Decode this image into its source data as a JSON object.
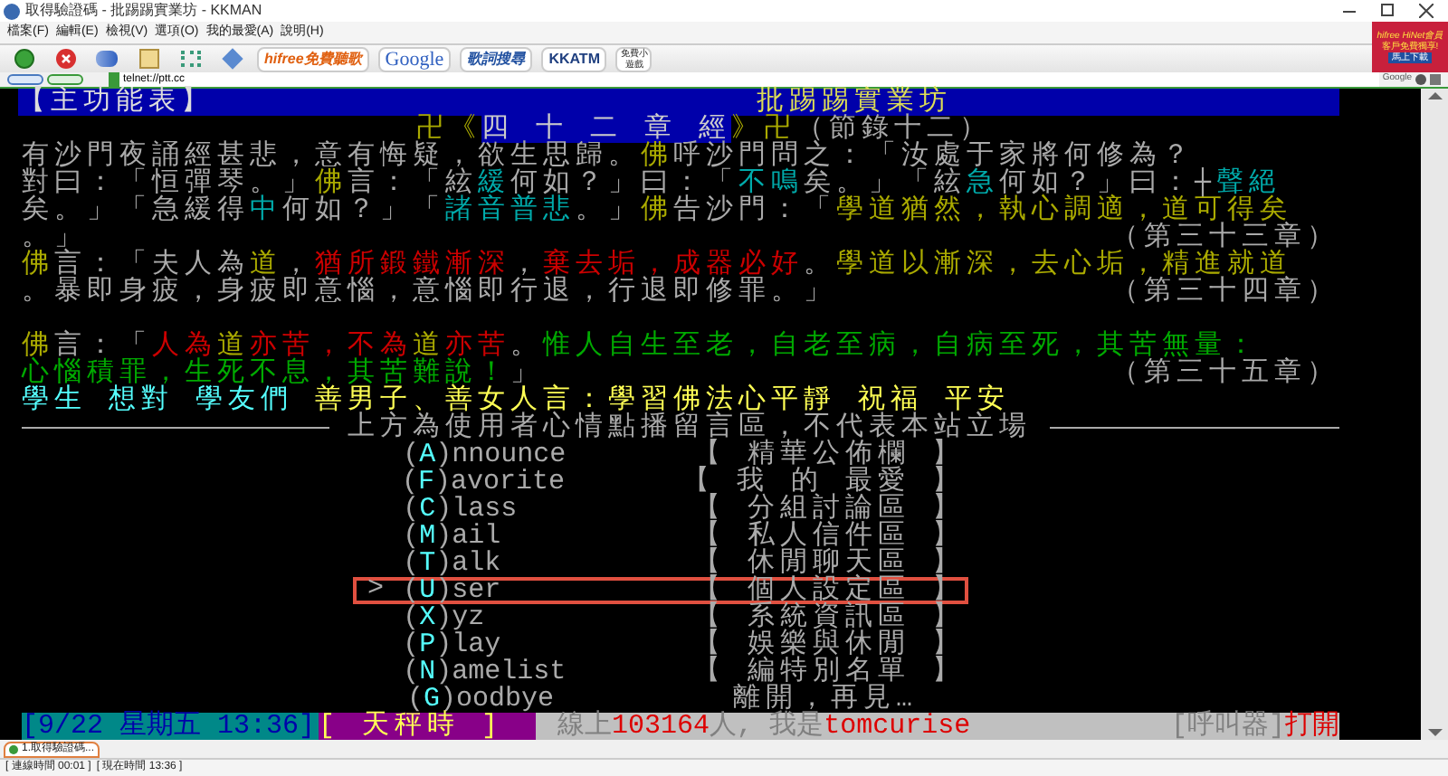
{
  "window": {
    "title": "取得驗證碼 - 批踢踢實業坊 - KKMAN"
  },
  "menu_bar": [
    "檔案(F)",
    "編輯(E)",
    "檢視(V)",
    "選項(O)",
    "我的最愛(A)",
    "說明(H)"
  ],
  "toolbar": {
    "links": [
      {
        "kind": "hifree",
        "label": "hifree免費聽歌"
      },
      {
        "kind": "google",
        "label": "Google"
      },
      {
        "kind": "lyrics",
        "label": "歌詞搜尋"
      },
      {
        "kind": "kkatm",
        "label": "KKATM"
      },
      {
        "kind": "games",
        "label": "免費小遊戲"
      }
    ]
  },
  "ad_banner": {
    "brand": "hifree",
    "title": "HiNet會員",
    "text": "客戶免費獨享!",
    "button": "馬上下載"
  },
  "address_bar": {
    "value": "telnet://ptt.cc",
    "search_label": "Google"
  },
  "terminal": {
    "header_left": "【主功能表】",
    "header_right": "批踢踢實業坊",
    "heading": [
      {
        "text": "卍《",
        "kind": "ornament"
      },
      {
        "text": "四 十 二 章 經",
        "kind": "highlight"
      },
      {
        "text": "》卍",
        "kind": "ornament"
      },
      {
        "text": "（節錄十二）",
        "kind": "note"
      }
    ],
    "sections": [
      {
        "lines": [
          {
            "segments": [
              {
                "text": "有沙門夜誦經甚悲，意有悔疑，欲生思歸。",
                "color": "#aaaaaa"
              },
              {
                "text": "佛",
                "color": "#aaaa00"
              },
              {
                "text": "呼沙門問之：「汝處于家將何修為？",
                "color": "#aaaaaa"
              }
            ]
          },
          {
            "segments": [
              {
                "text": "對曰：「恒彈琴。」",
                "color": "#aaaaaa"
              },
              {
                "text": "佛",
                "color": "#aaaa00"
              },
              {
                "text": "言：「絃",
                "color": "#aaaaaa"
              },
              {
                "text": "緩",
                "color": "#00aaaa"
              },
              {
                "text": "何如？」曰：「",
                "color": "#aaaaaa"
              },
              {
                "text": "不鳴",
                "color": "#00aaaa"
              },
              {
                "text": "矣。」「絃",
                "color": "#aaaaaa"
              },
              {
                "text": "急",
                "color": "#00aaaa"
              },
              {
                "text": "何如？」曰：┼",
                "color": "#aaaaaa"
              },
              {
                "text": "聲絕",
                "color": "#00aaaa"
              }
            ]
          },
          {
            "segments": [
              {
                "text": "矣。」「急緩得",
                "color": "#aaaaaa"
              },
              {
                "text": "中",
                "color": "#00aaaa"
              },
              {
                "text": "何如？」「",
                "color": "#aaaaaa"
              },
              {
                "text": "諸音普悲",
                "color": "#00aaaa"
              },
              {
                "text": "。」",
                "color": "#aaaaaa"
              },
              {
                "text": "佛",
                "color": "#aaaa00"
              },
              {
                "text": "告沙門：「",
                "color": "#aaaaaa"
              },
              {
                "text": "學道猶然，執心調適，道可得矣",
                "color": "#aaaa00"
              }
            ]
          },
          {
            "segments": [
              {
                "text": "。」",
                "color": "#aaaaaa"
              }
            ],
            "right": {
              "text": "（第三十三章）",
              "color": "#aaaaaa"
            }
          },
          {
            "segments": [
              {
                "text": "佛",
                "color": "#aaaa00"
              },
              {
                "text": "言：「夫人為",
                "color": "#aaaaaa"
              },
              {
                "text": "道",
                "color": "#aaaa00"
              },
              {
                "text": "，",
                "color": "#aaaaaa"
              },
              {
                "text": "猶所鍛鐵漸深",
                "color": "#cc0000"
              },
              {
                "text": "，",
                "color": "#aaaaaa"
              },
              {
                "text": "棄去垢",
                "color": "#cc0000"
              },
              {
                "text": "，",
                "color": "#cc0000"
              },
              {
                "text": "成器必好",
                "color": "#cc0000"
              },
              {
                "text": "。",
                "color": "#aaaaaa"
              },
              {
                "text": "學道以漸深，去心垢，精進就道",
                "color": "#aaaa00"
              }
            ]
          },
          {
            "segments": [
              {
                "text": "。暴即身疲，身疲即意惱，意惱即行退，行退即修罪。」",
                "color": "#aaaaaa"
              }
            ],
            "right": {
              "text": "（第三十四章）",
              "color": "#aaaaaa"
            }
          }
        ]
      },
      {
        "lines": [
          {
            "segments": [
              {
                "text": "佛",
                "color": "#aaaa00"
              },
              {
                "text": "言：「",
                "color": "#aaaaaa"
              },
              {
                "text": "人為",
                "color": "#cc0000"
              },
              {
                "text": "道",
                "color": "#aaaa00"
              },
              {
                "text": "亦苦，不為",
                "color": "#cc0000"
              },
              {
                "text": "道",
                "color": "#aaaa00"
              },
              {
                "text": "亦苦",
                "color": "#cc0000"
              },
              {
                "text": "。",
                "color": "#aaaaaa"
              },
              {
                "text": "惟人自生至老，自老至病，自病至死，其苦無量：",
                "color": "#00aa00"
              }
            ]
          },
          {
            "segments": [
              {
                "text": "心惱積罪，生死不息，其苦難說！",
                "color": "#00aa00"
              },
              {
                "text": "」",
                "color": "#aaaaaa"
              }
            ],
            "right": {
              "text": "（第三十五章）",
              "color": "#aaaaaa"
            }
          },
          {
            "segments": [
              {
                "text": "學生 想對 學友們 ",
                "color": "#55ffff"
              },
              {
                "text": "善男子、善女人言：學習佛法心平靜 祝福 平安",
                "color": "#ffff55"
              }
            ]
          }
        ]
      }
    ],
    "separator": "上方為使用者心情點播留言區，不代表本站立場",
    "cursor": ">",
    "menu": [
      {
        "label": "(A)nnounce",
        "description": "【 精華公佈欄 】",
        "selected": false
      },
      {
        "label": "(F)avorite",
        "description": "【 我 的 最愛 】",
        "selected": false
      },
      {
        "label": "(C)lass",
        "description": "【 分組討論區 】",
        "selected": false
      },
      {
        "label": "(M)ail",
        "description": "【 私人信件區 】",
        "selected": false
      },
      {
        "label": "(T)alk",
        "description": "【 休閒聊天區 】",
        "selected": false
      },
      {
        "label": "(U)ser",
        "description": "【 個人設定區 】",
        "selected": true
      },
      {
        "label": "(X)yz",
        "description": "【 系統資訊區 】",
        "selected": false
      },
      {
        "label": "(P)lay",
        "description": "【 娛樂與休閒 】",
        "selected": false
      },
      {
        "label": "(N)amelist",
        "description": "【 編特別名單 】",
        "selected": false
      },
      {
        "label": "(G)oodbye",
        "description": "離開，再見…",
        "selected": false
      }
    ],
    "status": {
      "date": "[9/22 星期五 13:36]",
      "sign": "[ 天秤時 ]",
      "info": [
        {
          "text": "線上",
          "color": "#808080"
        },
        {
          "text": "103164",
          "color": "#dd0000"
        },
        {
          "text": "人, 我是",
          "color": "#808080"
        },
        {
          "text": "tomcurise",
          "color": "#dd0000"
        }
      ],
      "pager": [
        {
          "text": "[呼叫器]",
          "color": "#808080"
        },
        {
          "text": "打開",
          "color": "#dd0000"
        }
      ]
    }
  },
  "tabs": [
    {
      "label": "1.取得驗證碼...",
      "selected": true
    }
  ],
  "status_bar": [
    "[ 連線時間 00:01 ]",
    "[ 現在時間 13:36 ]"
  ]
}
